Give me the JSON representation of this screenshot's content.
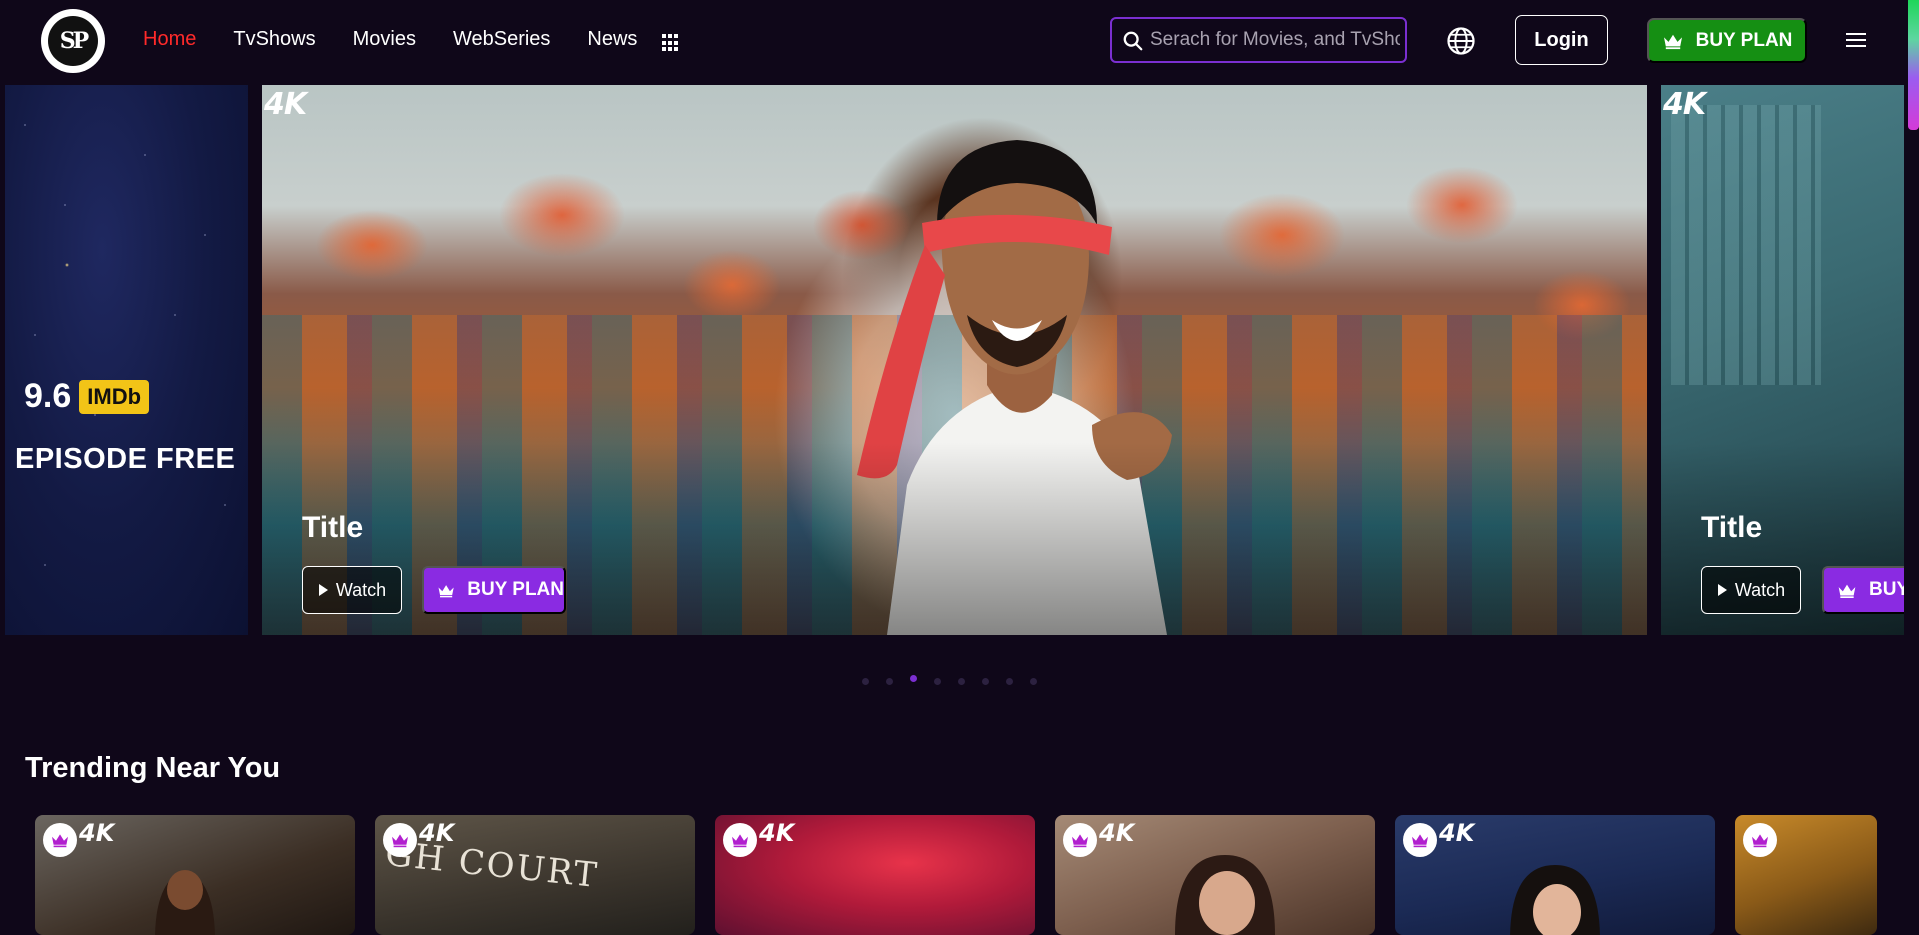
{
  "header": {
    "logo_text": "SP",
    "nav": [
      "Home",
      "TvShows",
      "Movies",
      "WebSeries",
      "News"
    ],
    "active_nav": "Home",
    "search_placeholder": "Serach for Movies, and TvShows",
    "login_label": "Login",
    "buy_plan_label": "BUY PLAN"
  },
  "carousel": {
    "left_slide": {
      "rating": "9.6",
      "rating_source": "IMDb",
      "tagline": "EPISODE FREE"
    },
    "main_slide": {
      "badge": "4K",
      "title": "Title",
      "watch_label": "Watch",
      "buy_label": "BUY PLAN"
    },
    "right_slide": {
      "badge": "4K",
      "title": "Title",
      "watch_label": "Watch",
      "buy_label": "BUY"
    },
    "dot_count": 8,
    "active_dot": 2
  },
  "trending": {
    "title": "Trending Near You",
    "cards": [
      {
        "badge": "4K"
      },
      {
        "badge": "4K",
        "poster_text": "GH COURT"
      },
      {
        "badge": "4K"
      },
      {
        "badge": "4K"
      },
      {
        "badge": "4K"
      },
      {
        "badge": ""
      }
    ]
  },
  "colors": {
    "background": "#0f0719",
    "active_nav": "#ff2a2a",
    "buy_plan_green": "#158f13",
    "accent_purple": "#8a2be2",
    "imdb_yellow": "#f2c417"
  }
}
